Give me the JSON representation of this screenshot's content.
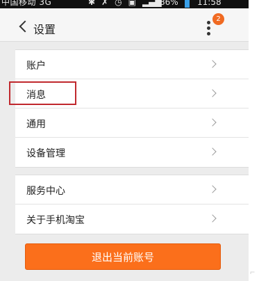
{
  "status_bar": {
    "carrier": "中国移动 3G",
    "battery": "86%",
    "time": "11:58",
    "icons": [
      "bluetooth-icon",
      "mute-icon",
      "alarm-icon",
      "sim-icon",
      "signal-icon"
    ]
  },
  "header": {
    "back_label": "设置",
    "badge_count": "2"
  },
  "groups": [
    {
      "items": [
        {
          "label": "账户"
        },
        {
          "label": "消息"
        },
        {
          "label": "通用"
        },
        {
          "label": "设备管理"
        }
      ]
    },
    {
      "items": [
        {
          "label": "服务中心"
        },
        {
          "label": "关于手机淘宝"
        }
      ]
    }
  ],
  "logout": {
    "label": "退出当前账号"
  },
  "colors": {
    "accent": "#fb6f1b",
    "badge": "#f06a22",
    "highlight_border": "#c0282d",
    "background": "#ececec"
  }
}
